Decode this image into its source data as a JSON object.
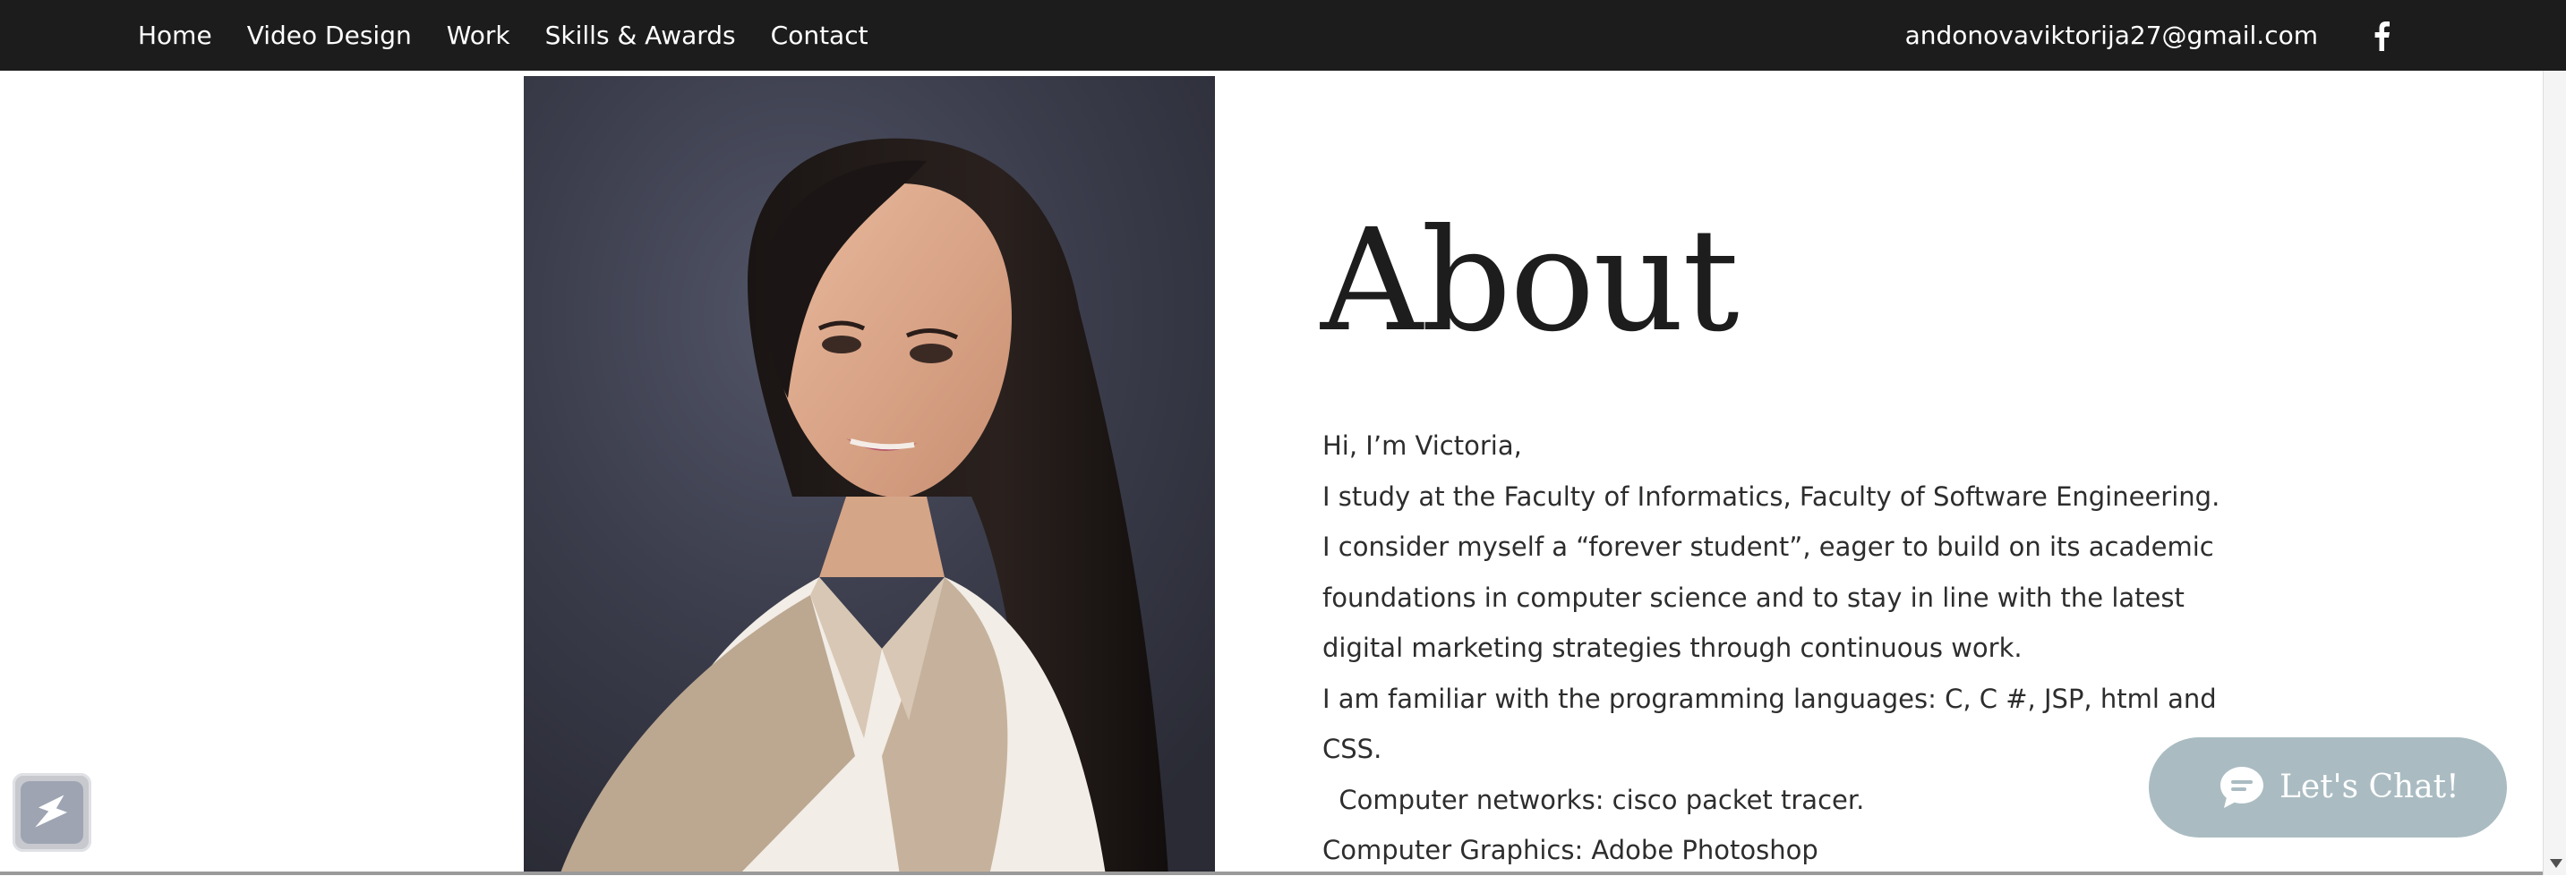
{
  "nav": {
    "items": [
      {
        "label": "Home"
      },
      {
        "label": "Video Design"
      },
      {
        "label": "Work"
      },
      {
        "label": "Skills & Awards"
      },
      {
        "label": "Contact"
      }
    ],
    "email": "andonovaviktorija27@gmail.com",
    "social_icon": "facebook-icon"
  },
  "about": {
    "title": "About",
    "lines": [
      "Hi, I’m Victoria,",
      "I study at the Faculty of Informatics, Faculty of Software Engineering.",
      "I consider myself a “forever student”, eager to build on its academic",
      "foundations in computer science and to stay in line with the latest",
      "digital marketing strategies through continuous work.",
      "I am familiar with the programming languages: C, C #, JSP, html and",
      "CSS.",
      "  Computer networks: cisco packet tracer.",
      "Computer Graphics: Adobe Photoshop"
    ]
  },
  "chat": {
    "label": "Let's Chat!",
    "icon": "chat-bubble-icon"
  },
  "colors": {
    "topbar": "#1c1c1c",
    "chat_button": "#aabcc2",
    "text": "#2d2d2d"
  }
}
